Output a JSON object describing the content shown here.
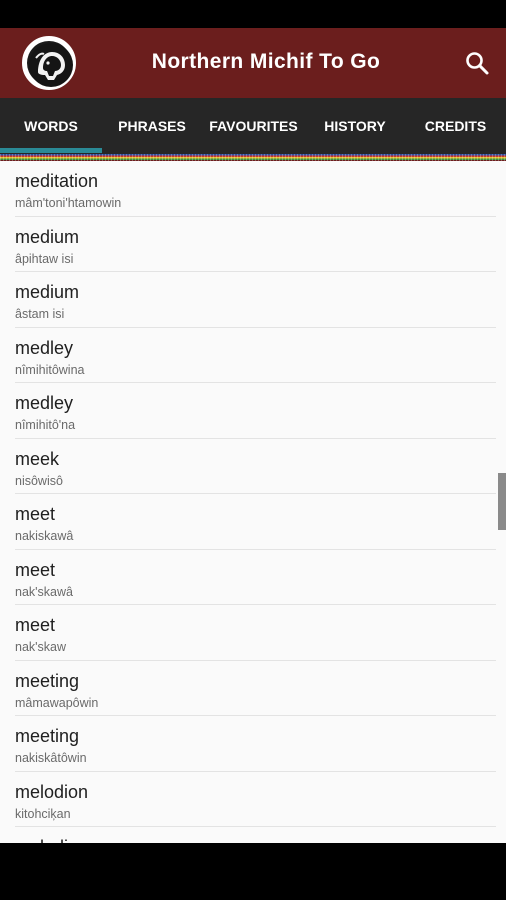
{
  "app_bar": {
    "title": "Northern Michif To Go",
    "logo_icon": "bison-logo-icon",
    "search_icon": "search-icon",
    "color": "#6b1e1d"
  },
  "tabs": [
    {
      "label": "WORDS",
      "selected": true
    },
    {
      "label": "PHRASES",
      "selected": false
    },
    {
      "label": "FAVOURITES",
      "selected": false
    },
    {
      "label": "HISTORY",
      "selected": false
    },
    {
      "label": "CREDITS",
      "selected": false
    }
  ],
  "accent": "#2a8a96",
  "entries": [
    {
      "word": "meditation",
      "translation": "mâm'toni'htamowin"
    },
    {
      "word": "medium",
      "translation": "âpihtaw isi"
    },
    {
      "word": "medium",
      "translation": "âstam isi"
    },
    {
      "word": "medley",
      "translation": "nîmihitôwina"
    },
    {
      "word": "medley",
      "translation": "nîmihitô'na"
    },
    {
      "word": "meek",
      "translation": "nisôwisô"
    },
    {
      "word": "meet",
      "translation": "nakiskawâ"
    },
    {
      "word": "meet",
      "translation": "nak'skawâ"
    },
    {
      "word": "meet",
      "translation": "nak'skaw"
    },
    {
      "word": "meeting",
      "translation": "mâmawapôwin"
    },
    {
      "word": "meeting",
      "translation": "nakiskâtôwin"
    },
    {
      "word": "melodion",
      "translation": "kitohciķan"
    },
    {
      "word": "melodious",
      "translation": ""
    }
  ]
}
